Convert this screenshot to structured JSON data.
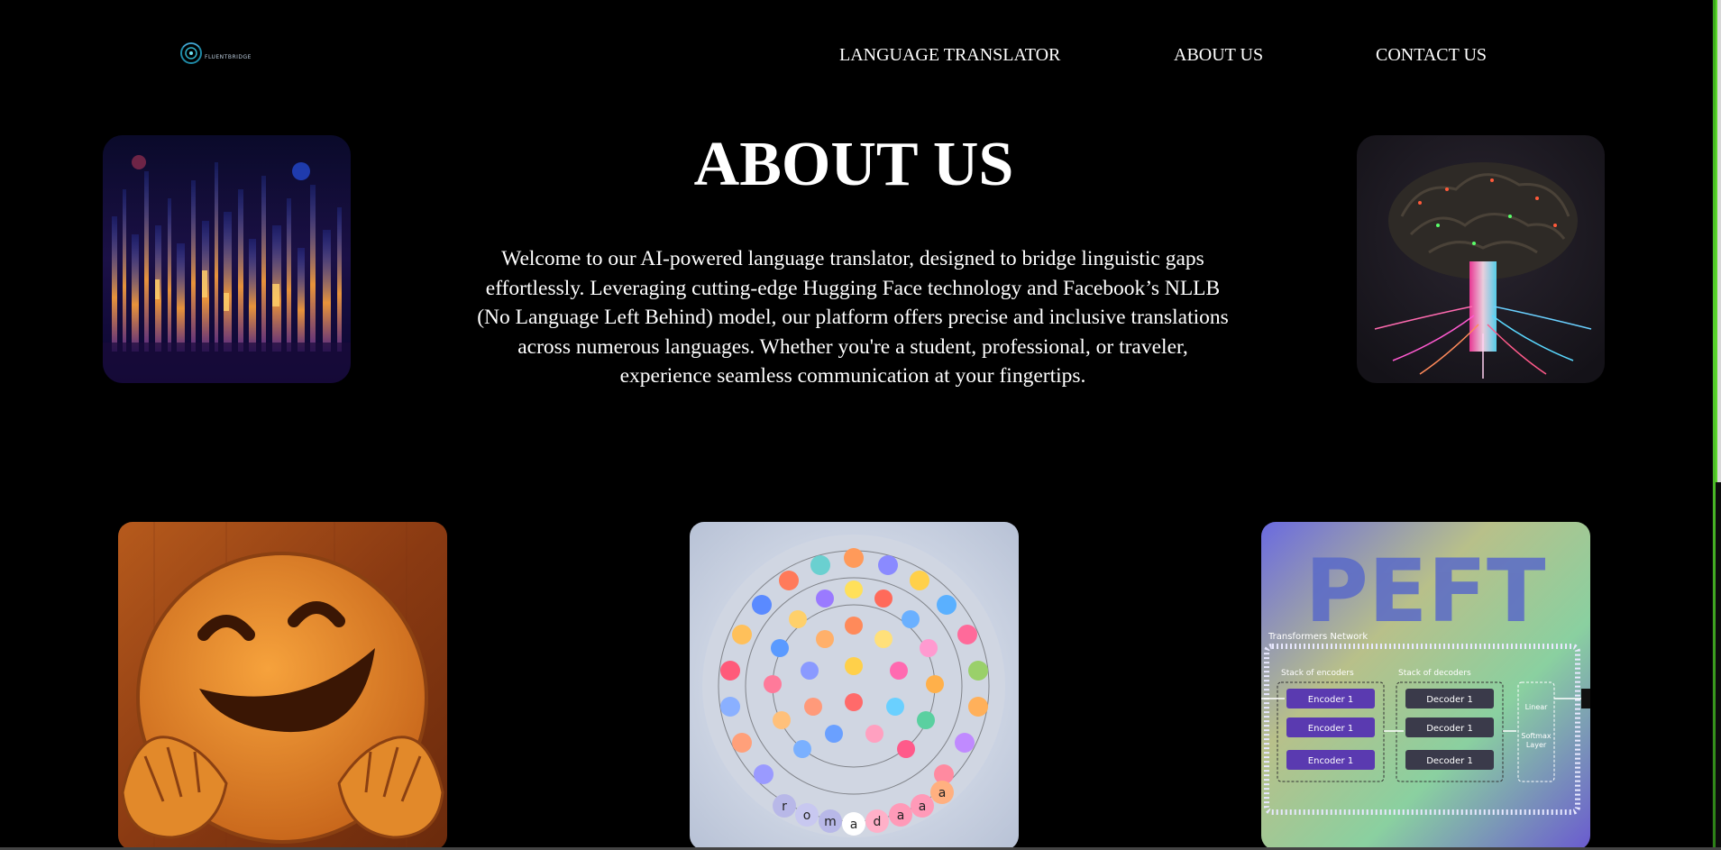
{
  "header": {
    "logo_text": "FLUENTBRIDGE",
    "nav": {
      "translator": "LANGUAGE TRANSLATOR",
      "about": "ABOUT US",
      "contact": "CONTACT US"
    }
  },
  "main": {
    "title": "ABOUT US",
    "description_lines": [
      "Welcome to our AI-powered language translator, designed to bridge linguistic gaps",
      "effortlessly. Leveraging cutting-edge Hugging Face technology and Facebook’s NLLB",
      "(No Language Left Behind) model, our platform offers precise and inclusive translations",
      "across numerous languages. Whether you're a student, professional, or traveler,",
      "experience seamless communication at your fingertips."
    ]
  },
  "peft_image": {
    "big_text": "PEFT",
    "network_label": "Transformers Network",
    "encoders_label": "Stack of encoders",
    "decoders_label": "Stack of decoders",
    "encoder_block": "Encoder 1",
    "decoder_block": "Decoder 1",
    "linear_label": "Linear",
    "softmax_label": "Softmax",
    "layer_label": "Layer"
  },
  "token_image": {
    "bottom_letters": [
      "r",
      "o",
      "m",
      "a",
      "d",
      "a",
      "a",
      "a"
    ]
  },
  "icons": [
    "logo-icon",
    "digital-city-image",
    "neural-brain-image",
    "hugging-face-image",
    "token-circle-image",
    "peft-diagram-image"
  ],
  "colors": {
    "background": "#000000",
    "text": "#ffffff",
    "scroll_accent": "#56d02d"
  }
}
